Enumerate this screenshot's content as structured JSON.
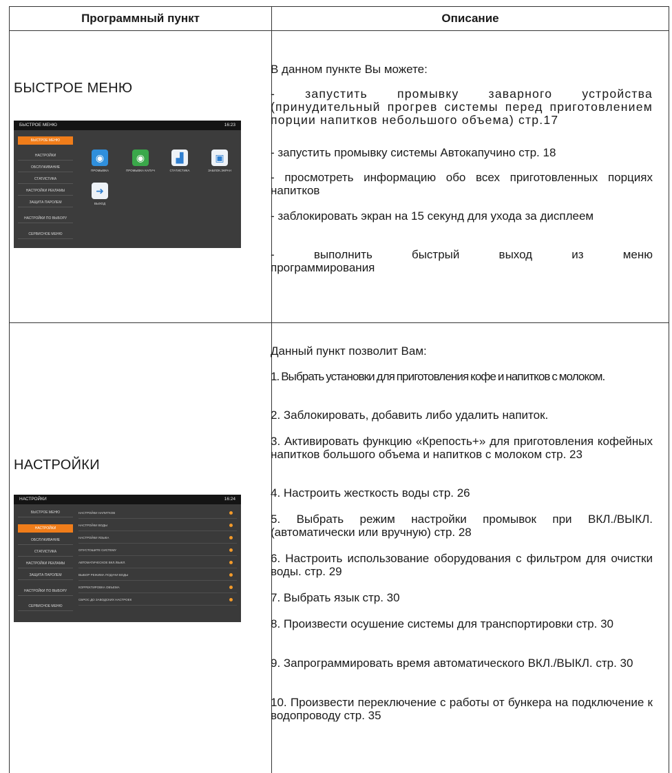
{
  "header": {
    "col1": "Программный пункт",
    "col2": "Описание"
  },
  "rows": [
    {
      "title": "БЫСТРОЕ МЕНЮ",
      "screen": {
        "title": "БЫСТРОЕ МЕНЮ",
        "clock": "16:23",
        "menu": [
          "БЫСТРОЕ МЕНЮ",
          "НАСТРОЙКИ",
          "ОБСЛУЖИВАНИЕ",
          "СТАТИСТИКА",
          "НАСТРОЙКИ РЕКЛАМЫ",
          "ЗАЩИТА ПАРОЛЕМ",
          "НАСТРОЙКИ ПО ВЫБОРУ",
          "СЕРВИСНОЕ МЕНЮ"
        ],
        "tiles": [
          "ПРОМЫВКА",
          "ПРОМЫВКА КАПУЧ",
          "СТАТИСТИКА",
          "ЗАБЛОК.ЭКРАН",
          "ВЫХОД"
        ]
      },
      "paragraphs": [
        "В данном пункте Вы можете:",
        "- запустить промывку заварного устройства (принудительный прогрев системы перед приготовлением порции напитков небольшого объема) стр.17",
        "- запустить промывку системы Автокапучино стр. 18",
        "- просмотреть информацию обо всех приготовленных порциях напитков",
        "- заблокировать экран на 15 секунд для ухода за дисплеем",
        "- выполнить быстрый выход из меню программирования"
      ]
    },
    {
      "title": "НАСТРОЙКИ",
      "screen": {
        "title": "НАСТРОЙКИ",
        "clock": "16:24",
        "menu": [
          "БЫСТРОЕ МЕНЮ",
          "НАСТРОЙКИ",
          "ОБСЛУЖИВАНИЕ",
          "СТАТИСТИКА",
          "НАСТРОЙКИ РЕКЛАМЫ",
          "ЗАЩИТА ПАРОЛЕМ",
          "НАСТРОЙКИ ПО ВЫБОРУ",
          "СЕРВИСНОЕ МЕНЮ"
        ],
        "settings": [
          "НАСТРОЙКИ НАПИТКОВ",
          "НАСТРОЙКИ ВОДЫ",
          "НАСТРОЙКИ ЯЗЫКА",
          "ОПУСТОШИТЕ СИСТЕМУ",
          "АВТОМАТИЧЕСКОЕ ВКЛ./ВЫКЛ.",
          "ВЫБОР РЕЖИМА ПОДАЧИ ВОДЫ",
          "КОРРЕКТИРОВКА ОБЪЕМА",
          "СБРОС ДО ЗАВОДСКИХ НАСТРОЕК"
        ]
      },
      "paragraphs": [
        "Данный пункт позволит Вам:",
        "1. Выбрать установки для приготовления кофе и напитков с молоком.",
        "2. Заблокировать, добавить либо удалить напиток.",
        "3. Активировать функцию «Крепость+» для приготовления кофейных напитков большого объема и напитков с молоком стр. 23",
        "4. Настроить жесткость воды стр. 26",
        "5. Выбрать режим настройки промывок при ВКЛ./ВЫКЛ. (автоматически или вручную) стр. 28",
        "6. Настроить использование оборудования с фильтром для очистки воды. стр. 29",
        "7. Выбрать язык стр. 30",
        "8. Произвести осушение системы для транспортировки стр. 30",
        "9. Запрограммировать время автоматического ВКЛ./ВЫКЛ. стр. 30",
        "10. Произвести переключение с работы от бункера на подключение к водопроводу стр. 35"
      ]
    }
  ]
}
